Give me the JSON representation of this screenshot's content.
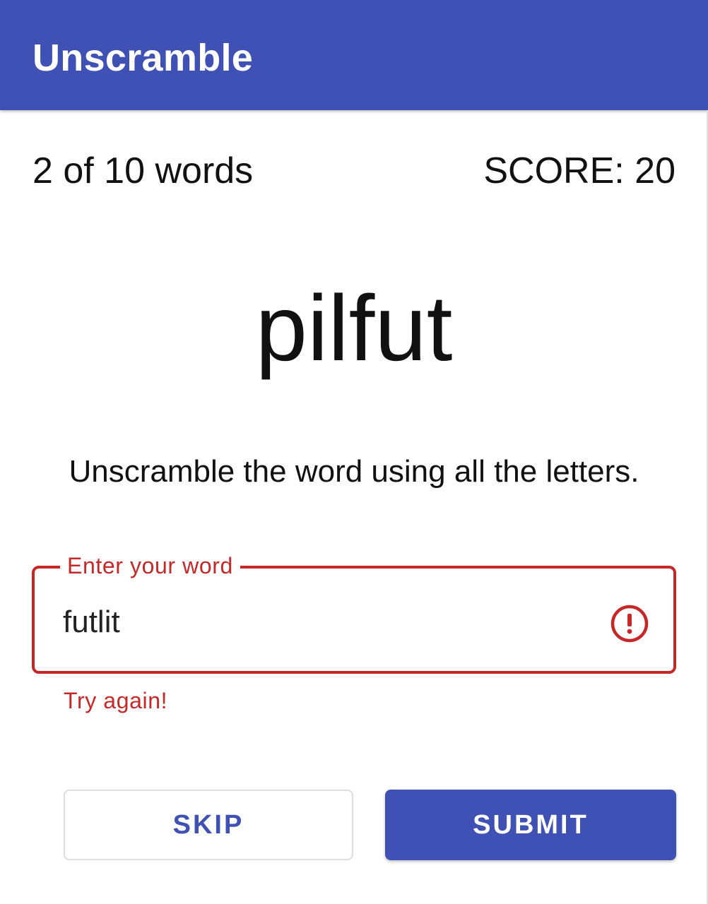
{
  "app_bar": {
    "title": "Unscramble",
    "color": "#3f51b5"
  },
  "status": {
    "word_count": "2 of 10 words",
    "score": "SCORE: 20"
  },
  "game": {
    "scrambled_word": "pilfut",
    "instructions": "Unscramble the word using all the letters."
  },
  "input": {
    "label": "Enter your word",
    "value": "futlit",
    "helper_error": "Try again!",
    "error_color": "#c62828",
    "trailing_icon": "error-icon"
  },
  "buttons": {
    "skip_label": "SKIP",
    "submit_label": "SUBMIT"
  }
}
